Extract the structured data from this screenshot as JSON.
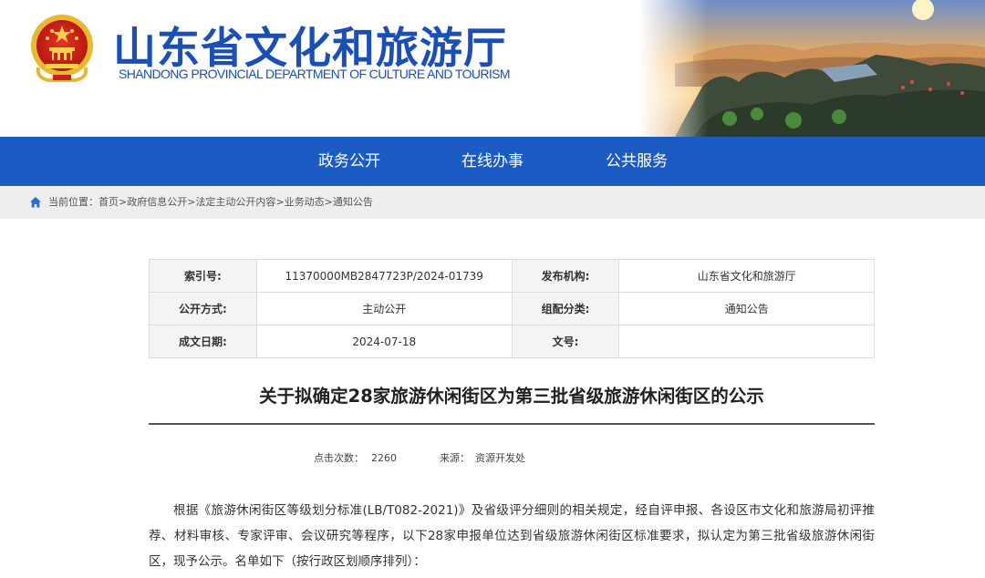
{
  "header": {
    "title": "山东省文化和旅游厅",
    "subtitle": "SHANDONG PROVINCIAL DEPARTMENT OF CULTURE AND TOURISM",
    "brand_color": "#1a4fb5"
  },
  "nav": {
    "items": [
      {
        "label": "政务公开"
      },
      {
        "label": "在线办事"
      },
      {
        "label": "公共服务"
      }
    ],
    "background": "#1d5bc4"
  },
  "breadcrumb": {
    "icon": "home-icon",
    "prefix": "当前位置：",
    "items": [
      "首页",
      "政府信息公开",
      "法定主动公开内容",
      "业务动态",
      "通知公告"
    ],
    "separator": ">"
  },
  "meta": {
    "index_label": "索引号:",
    "index_value": "11370000MB2847723P/2024-01739",
    "publisher_label": "发布机构:",
    "publisher_value": "山东省文化和旅游厅",
    "disclosure_label": "公开方式:",
    "disclosure_value": "主动公开",
    "category_label": "组配分类:",
    "category_value": "通知公告",
    "date_label": "成文日期:",
    "date_value": "2024-07-18",
    "docno_label": "文号:",
    "docno_value": ""
  },
  "article": {
    "title": "关于拟确定28家旅游休闲街区为第三批省级旅游休闲街区的公示",
    "views_label": "点击次数：",
    "views_value": "2260",
    "source_label": "来源：",
    "source_value": "资源开发处",
    "body": "根据《旅游休闲街区等级划分标准(LB/T082-2021)》及省级评分细则的相关规定，经自评申报、各设区市文化和旅游局初评推荐、材料审核、专家评审、会议研究等程序，以下28家申报单位达到省级旅游休闲街区标准要求，拟认定为第三批省级旅游休闲街区，现予公示。名单如下（按行政区划顺序排列）："
  }
}
